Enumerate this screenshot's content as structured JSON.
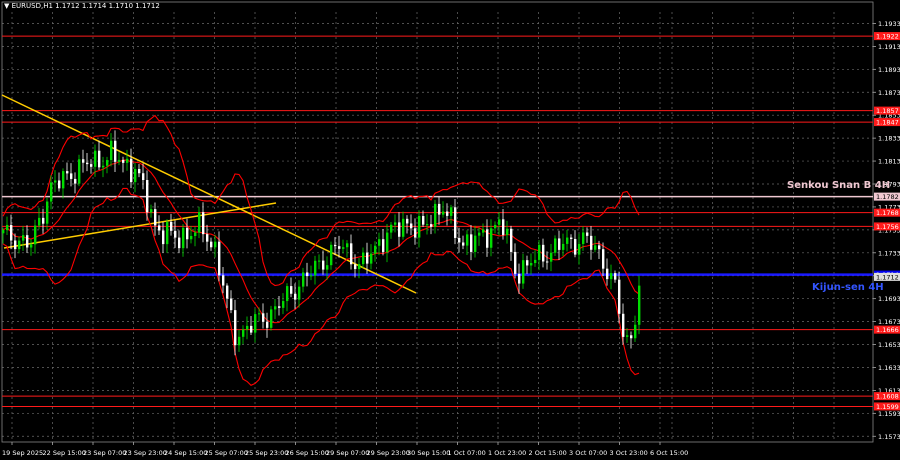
{
  "window": {
    "title": "▼ EURUSD,H1  1.1712 1.1714 1.1710 1.1712"
  },
  "colors": {
    "background": "#000000",
    "grid": "#6b6b6b",
    "axis_text": "#ffffff",
    "level_red": "#ff1a1a",
    "kijun_blue": "#1a1aff",
    "senkou_pink": "#f0c8d2",
    "trend_yellow": "#ffcc00",
    "indicator_red": "#ff0000",
    "candle_green": "#00dd00",
    "candle_white": "#ffffff"
  },
  "labels": {
    "senkou": "Senkou Snan B 4H",
    "kijun": "Kijun-sen 4H"
  },
  "price_axis": {
    "ticks": [
      "1.1933",
      "1.1913",
      "1.1893",
      "1.1873",
      "1.1853",
      "1.1833",
      "1.1813",
      "1.1793",
      "1.1773",
      "1.1753",
      "1.1733",
      "1.1713",
      "1.1693",
      "1.1673",
      "1.1653",
      "1.1633",
      "1.1613",
      "1.1593",
      "1.1573"
    ]
  },
  "price_tags": {
    "current": "1.1712",
    "red": [
      "1.1922",
      "1.1857",
      "1.1847",
      "1.1768",
      "1.1756",
      "1.1666",
      "1.1608",
      "1.1599"
    ],
    "senkou": "1.1782",
    "kijun": "1.1714"
  },
  "time_axis": {
    "ticks": [
      "19 Sep 2025",
      "22 Sep 15:00",
      "23 Sep 07:00",
      "23 Sep 23:00",
      "24 Sep 15:00",
      "25 Sep 07:00",
      "25 Sep 23:00",
      "26 Sep 15:00",
      "29 Sep 07:00",
      "29 Sep 23:00",
      "30 Sep 15:00",
      "1 Oct 07:00",
      "1 Oct 23:00",
      "2 Oct 15:00",
      "3 Oct 07:00",
      "3 Oct 23:00",
      "6 Oct 15:00"
    ]
  }
}
